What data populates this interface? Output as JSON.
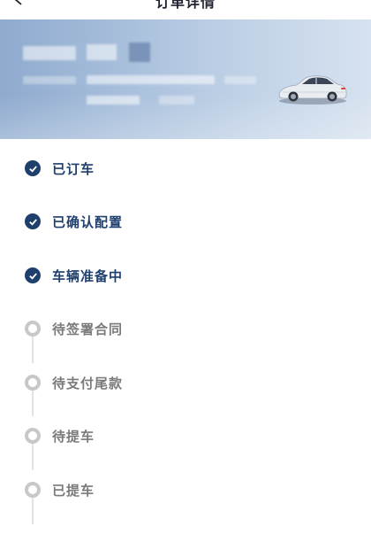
{
  "nav": {
    "title": "订单详情"
  },
  "banner": {
    "car_image": "sedan-car-image"
  },
  "steps": [
    {
      "label": "已订车",
      "status": "done"
    },
    {
      "label": "已确认配置",
      "status": "done"
    },
    {
      "label": "车辆准备中",
      "status": "done"
    },
    {
      "label": "待签署合同",
      "status": "todo"
    },
    {
      "label": "待支付尾款",
      "status": "todo"
    },
    {
      "label": "待提车",
      "status": "todo"
    },
    {
      "label": "已提车",
      "status": "todo"
    }
  ],
  "colors": {
    "done": "#1f3f6d",
    "todo": "#c8c8c8",
    "banner_start": "#8eaace",
    "banner_end": "#d6e2ef"
  }
}
